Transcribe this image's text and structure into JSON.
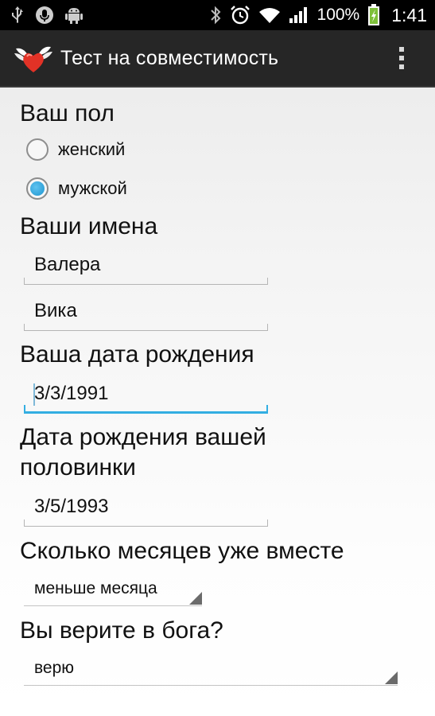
{
  "status_bar": {
    "icons_left": [
      "usb-icon",
      "microphone-icon",
      "android-icon"
    ],
    "icons_right": [
      "bluetooth-icon",
      "alarm-icon",
      "wifi-icon",
      "signal-icon"
    ],
    "battery_percent": "100%",
    "time": "1:41"
  },
  "action_bar": {
    "title": "Тест на совместимость",
    "logo_icon": "winged-heart-icon",
    "menu_icon": "overflow-menu-icon"
  },
  "form": {
    "gender": {
      "label": "Ваш пол",
      "options": [
        {
          "label": "женский",
          "checked": false
        },
        {
          "label": "мужской",
          "checked": true
        }
      ]
    },
    "names": {
      "label": "Ваши имена",
      "name1": "Валера",
      "name2": "Вика"
    },
    "birth_date": {
      "label": "Ваша дата рождения",
      "value": "3/3/1991"
    },
    "partner_birth_date": {
      "label_line1": "Дата рождения вашей",
      "label_line2": "половинки",
      "value": "3/5/1993"
    },
    "months_together": {
      "label": "Сколько месяцев уже вместе",
      "selected": "меньше месяца"
    },
    "believe_in_god": {
      "label": "Вы верите в бога?",
      "selected": "верю"
    }
  },
  "colors": {
    "accent": "#33aee2",
    "status_bar": "#000000",
    "action_bar": "#262626"
  }
}
